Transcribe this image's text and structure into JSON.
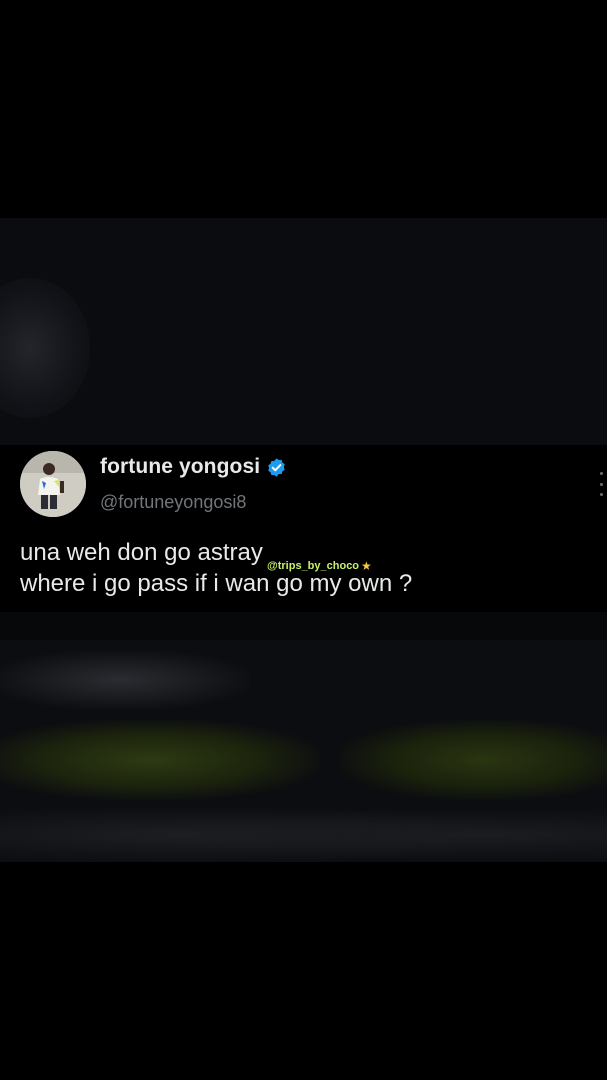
{
  "tweet": {
    "display_name": "fortune yongosi",
    "handle": "@fortuneyongosi8",
    "verified": true,
    "text_lines": [
      "una weh don go astray",
      "where i go pass if i wan go my own ?"
    ]
  },
  "watermark": {
    "text": "@trips_by_choco",
    "star": "★"
  },
  "colors": {
    "background": "#000000",
    "text_primary": "#e7e9ea",
    "text_secondary": "#71767b",
    "verified_blue": "#1d9bf0",
    "watermark_green": "#c9f06a"
  },
  "icons": {
    "verified": "verified-badge-icon",
    "menu": "vertical-dots-icon"
  }
}
